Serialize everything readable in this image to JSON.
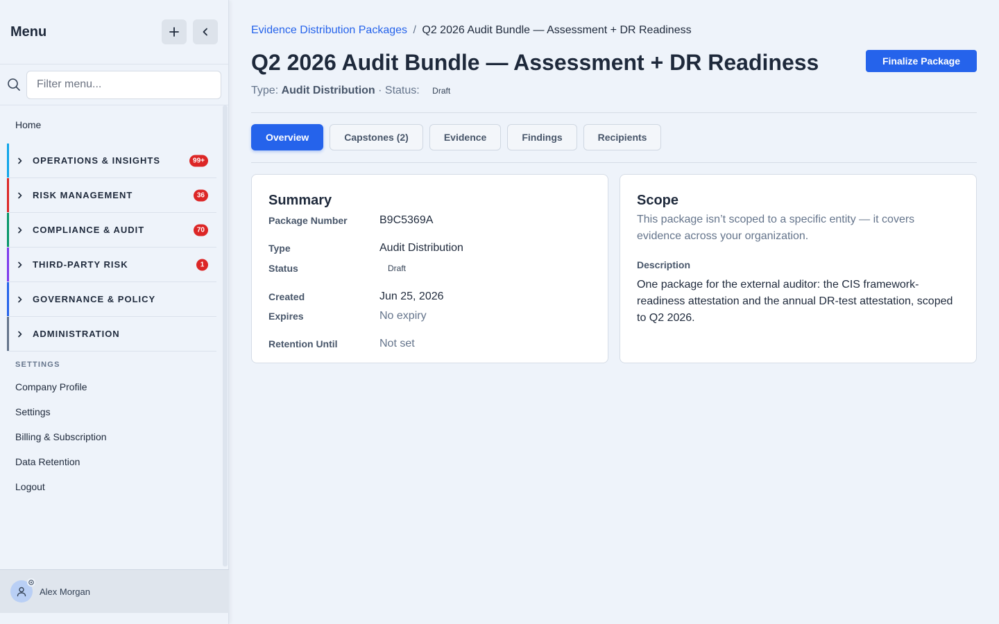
{
  "sidebar": {
    "title": "Menu",
    "filter_placeholder": "Filter menu...",
    "home": "Home",
    "groups": [
      {
        "label": "OPERATIONS & INSIGHTS",
        "badge": "99+",
        "accent": "#0ea5e9"
      },
      {
        "label": "RISK MANAGEMENT",
        "badge": "36",
        "accent": "#dc2626"
      },
      {
        "label": "COMPLIANCE & AUDIT",
        "badge": "70",
        "accent": "#059669"
      },
      {
        "label": "THIRD-PARTY RISK",
        "badge": "1",
        "accent": "#7c3aed"
      },
      {
        "label": "GOVERNANCE & POLICY",
        "badge": "",
        "accent": "#2563eb"
      },
      {
        "label": "ADMINISTRATION",
        "badge": "",
        "accent": "#64748b"
      }
    ],
    "settings_title": "SETTINGS",
    "settings_links": [
      "Company Profile",
      "Settings",
      "Billing & Subscription",
      "Data Retention",
      "Logout"
    ],
    "user_name": "Alex Morgan"
  },
  "breadcrumb": {
    "parent": "Evidence Distribution Packages",
    "separator": "/",
    "current": "Q2 2026 Audit Bundle — Assessment + DR Readiness"
  },
  "page": {
    "title": "Q2 2026 Audit Bundle — Assessment + DR Readiness",
    "finalize_label": "Finalize Package",
    "meta_type_label": "Type:",
    "meta_type_value": "Audit Distribution",
    "meta_status_label": "· Status:",
    "meta_status_value": "Draft"
  },
  "tabs": [
    {
      "label": "Overview",
      "active": true
    },
    {
      "label": "Capstones (2)",
      "active": false
    },
    {
      "label": "Evidence",
      "active": false
    },
    {
      "label": "Findings",
      "active": false
    },
    {
      "label": "Recipients",
      "active": false
    }
  ],
  "summary": {
    "title": "Summary",
    "rows": [
      {
        "label": "Package Number",
        "value": "B9C5369A"
      },
      {
        "label": "Type",
        "value": "Audit Distribution"
      },
      {
        "label": "Status",
        "value": "Draft"
      },
      {
        "label": "Created",
        "value": "Jun 25, 2026"
      },
      {
        "label": "Expires",
        "value": "No expiry"
      },
      {
        "label": "Retention Until",
        "value": "Not set"
      }
    ]
  },
  "scope": {
    "title": "Scope",
    "text": "This package isn’t scoped to a specific entity — it covers evidence across your organization.",
    "description_label": "Description",
    "description": "One package for the external auditor: the CIS framework-readiness attestation and the annual DR-test attestation, scoped to Q2 2026."
  },
  "colors": {
    "primary": "#2563eb",
    "badge": "#dc2626"
  }
}
